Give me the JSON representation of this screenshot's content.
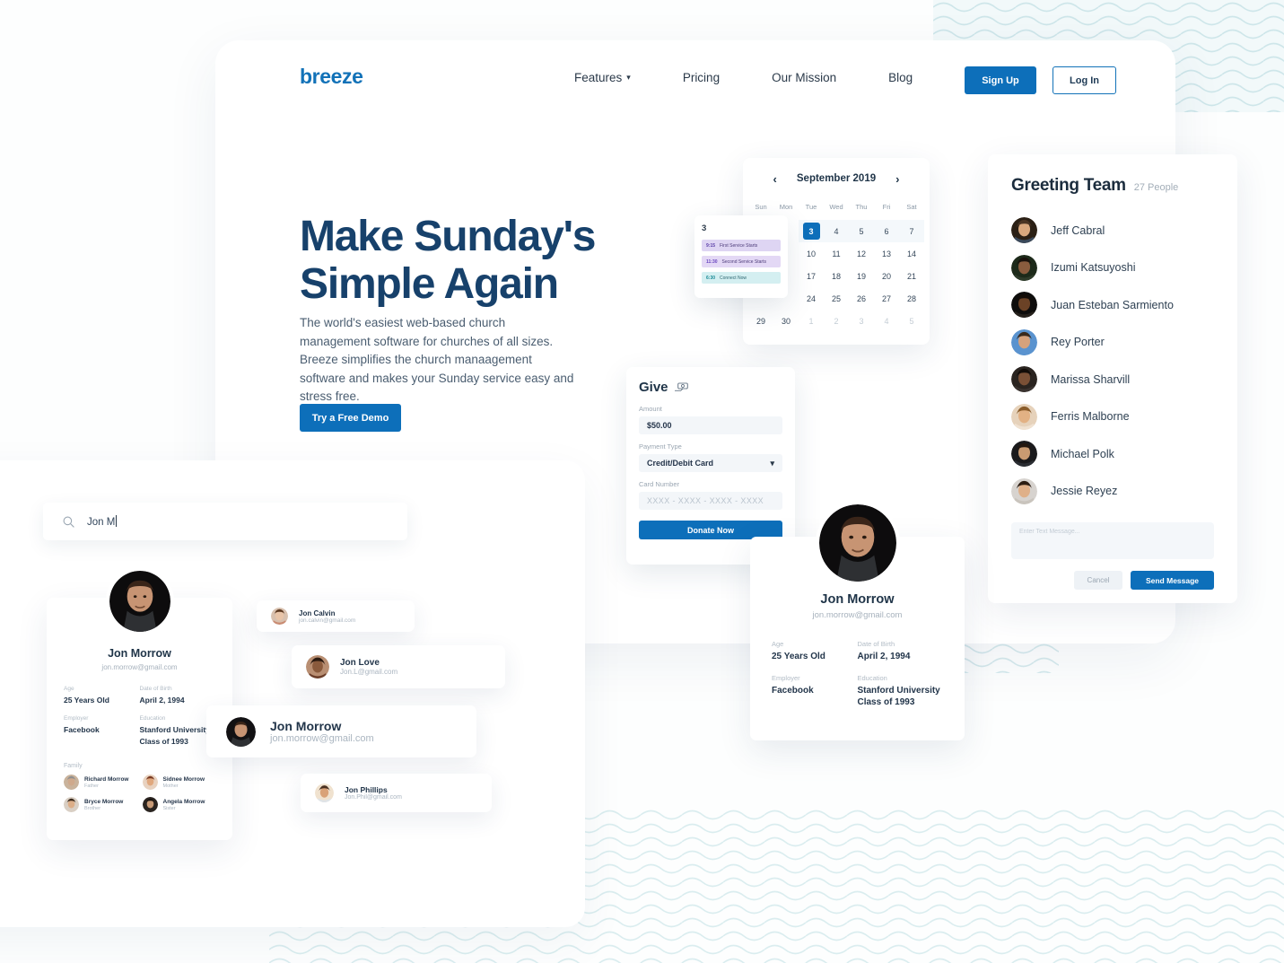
{
  "brand": {
    "logo": "breeze",
    "accent": "#0d6fba",
    "dark": "#17416b"
  },
  "nav": {
    "links": [
      {
        "label": "Features",
        "has_caret": true,
        "icon": "chevron-down-icon"
      },
      {
        "label": "Pricing",
        "has_caret": false
      },
      {
        "label": "Our Mission",
        "has_caret": false
      },
      {
        "label": "Blog",
        "has_caret": false
      }
    ],
    "signup_label": "Sign Up",
    "login_label": "Log In"
  },
  "hero": {
    "title": "Make Sunday's Simple Again",
    "subtitle": "The world's easiest web-based church management software for churches of all sizes. Breeze simplifies the church manaagement software and makes your Sunday service easy and stress free.",
    "cta_label": "Try a Free Demo"
  },
  "calendar": {
    "month_label": "September 2019",
    "prev_icon": "chevron-left-icon",
    "next_icon": "chevron-right-icon",
    "dow": [
      "Sun",
      "Mon",
      "Tue",
      "Wed",
      "Thu",
      "Fri",
      "Sat"
    ],
    "weeks": [
      [
        {
          "d": "",
          "muted": false,
          "blank": true
        },
        {
          "d": "",
          "muted": false,
          "blank": true
        },
        {
          "d": "3",
          "sel": true
        },
        {
          "d": "4"
        },
        {
          "d": "5"
        },
        {
          "d": "6"
        },
        {
          "d": "7"
        }
      ],
      [
        {
          "d": "",
          "blank": true
        },
        {
          "d": "",
          "blank": true
        },
        {
          "d": "10"
        },
        {
          "d": "11"
        },
        {
          "d": "12"
        },
        {
          "d": "13"
        },
        {
          "d": "14"
        }
      ],
      [
        {
          "d": "",
          "blank": true
        },
        {
          "d": "",
          "blank": true
        },
        {
          "d": "17"
        },
        {
          "d": "18"
        },
        {
          "d": "19"
        },
        {
          "d": "20"
        },
        {
          "d": "21"
        }
      ],
      [
        {
          "d": "",
          "blank": true
        },
        {
          "d": "",
          "blank": true
        },
        {
          "d": "24"
        },
        {
          "d": "25"
        },
        {
          "d": "26"
        },
        {
          "d": "27"
        },
        {
          "d": "28"
        }
      ],
      [
        {
          "d": "29"
        },
        {
          "d": "30"
        },
        {
          "d": "1",
          "muted": true
        },
        {
          "d": "2",
          "muted": true
        },
        {
          "d": "3",
          "muted": true
        },
        {
          "d": "4",
          "muted": true
        },
        {
          "d": "5",
          "muted": true
        }
      ]
    ],
    "popover": {
      "date": "3",
      "events": [
        {
          "time": "9:15",
          "name": "First Service Starts",
          "color": "purple"
        },
        {
          "time": "11:30",
          "name": "Second Service Starts",
          "color": "purple"
        },
        {
          "time": "6:30",
          "name": "Connect Now",
          "color": "teal"
        }
      ]
    }
  },
  "give": {
    "title": "Give",
    "title_icon": "money-hand-icon",
    "amount_label": "Amount",
    "amount_value": "$50.00",
    "payment_label": "Payment Type",
    "payment_value": "Credit/Debit Card",
    "payment_caret_icon": "chevron-down-icon",
    "card_label": "Card Number",
    "card_placeholder": "XXXX - XXXX - XXXX - XXXX",
    "submit_label": "Donate Now"
  },
  "team": {
    "title": "Greeting Team",
    "count": "27 People",
    "members": [
      {
        "name": "Jeff Cabral"
      },
      {
        "name": "Izumi Katsuyoshi"
      },
      {
        "name": "Juan Esteban Sarmiento"
      },
      {
        "name": "Rey Porter"
      },
      {
        "name": "Marissa Sharvill"
      },
      {
        "name": "Ferris Malborne"
      },
      {
        "name": "Michael Polk"
      },
      {
        "name": "Jessie Reyez"
      }
    ],
    "message_placeholder": "Enter Text Message...",
    "cancel_label": "Cancel",
    "send_label": "Send Message"
  },
  "profile": {
    "name": "Jon Morrow",
    "email": "jon.morrow@gmail.com",
    "fields": [
      {
        "label": "Age",
        "value": "25 Years Old"
      },
      {
        "label": "Date of Birth",
        "value": "April 2, 1994"
      },
      {
        "label": "Employer",
        "value": "Facebook"
      },
      {
        "label": "Education",
        "value": "Stanford University Class of 1993"
      }
    ],
    "family_label": "Family",
    "family": [
      {
        "name": "Richard Morrow",
        "relation": "Father"
      },
      {
        "name": "Sidnee Morrow",
        "relation": "Mother"
      },
      {
        "name": "Bryce Morrow",
        "relation": "Brother"
      },
      {
        "name": "Angela Morrow",
        "relation": "Sister"
      }
    ]
  },
  "search": {
    "icon": "search-icon",
    "value": "Jon M",
    "results": [
      {
        "name": "Jon Calvin",
        "email": "jon.calvin@gmail.com"
      },
      {
        "name": "Jon Love",
        "email": "Jon.L@gmail.com"
      },
      {
        "name": "Jon Morrow",
        "email": "jon.morrow@gmail.com"
      },
      {
        "name": "Jon Phillips",
        "email": "Jon.Phil@gmail.com"
      }
    ]
  },
  "decor": {
    "blob_blue_dark": "#0f5c96",
    "blob_blue_light": "#3d9ff0",
    "blob_teal_dark": "#11a8a0",
    "blob_teal_light": "#49d6d0",
    "blob_purple_dark": "#7b1fa2",
    "blob_purple_light": "#c06ce0",
    "wave_color": "#bedfe3"
  }
}
